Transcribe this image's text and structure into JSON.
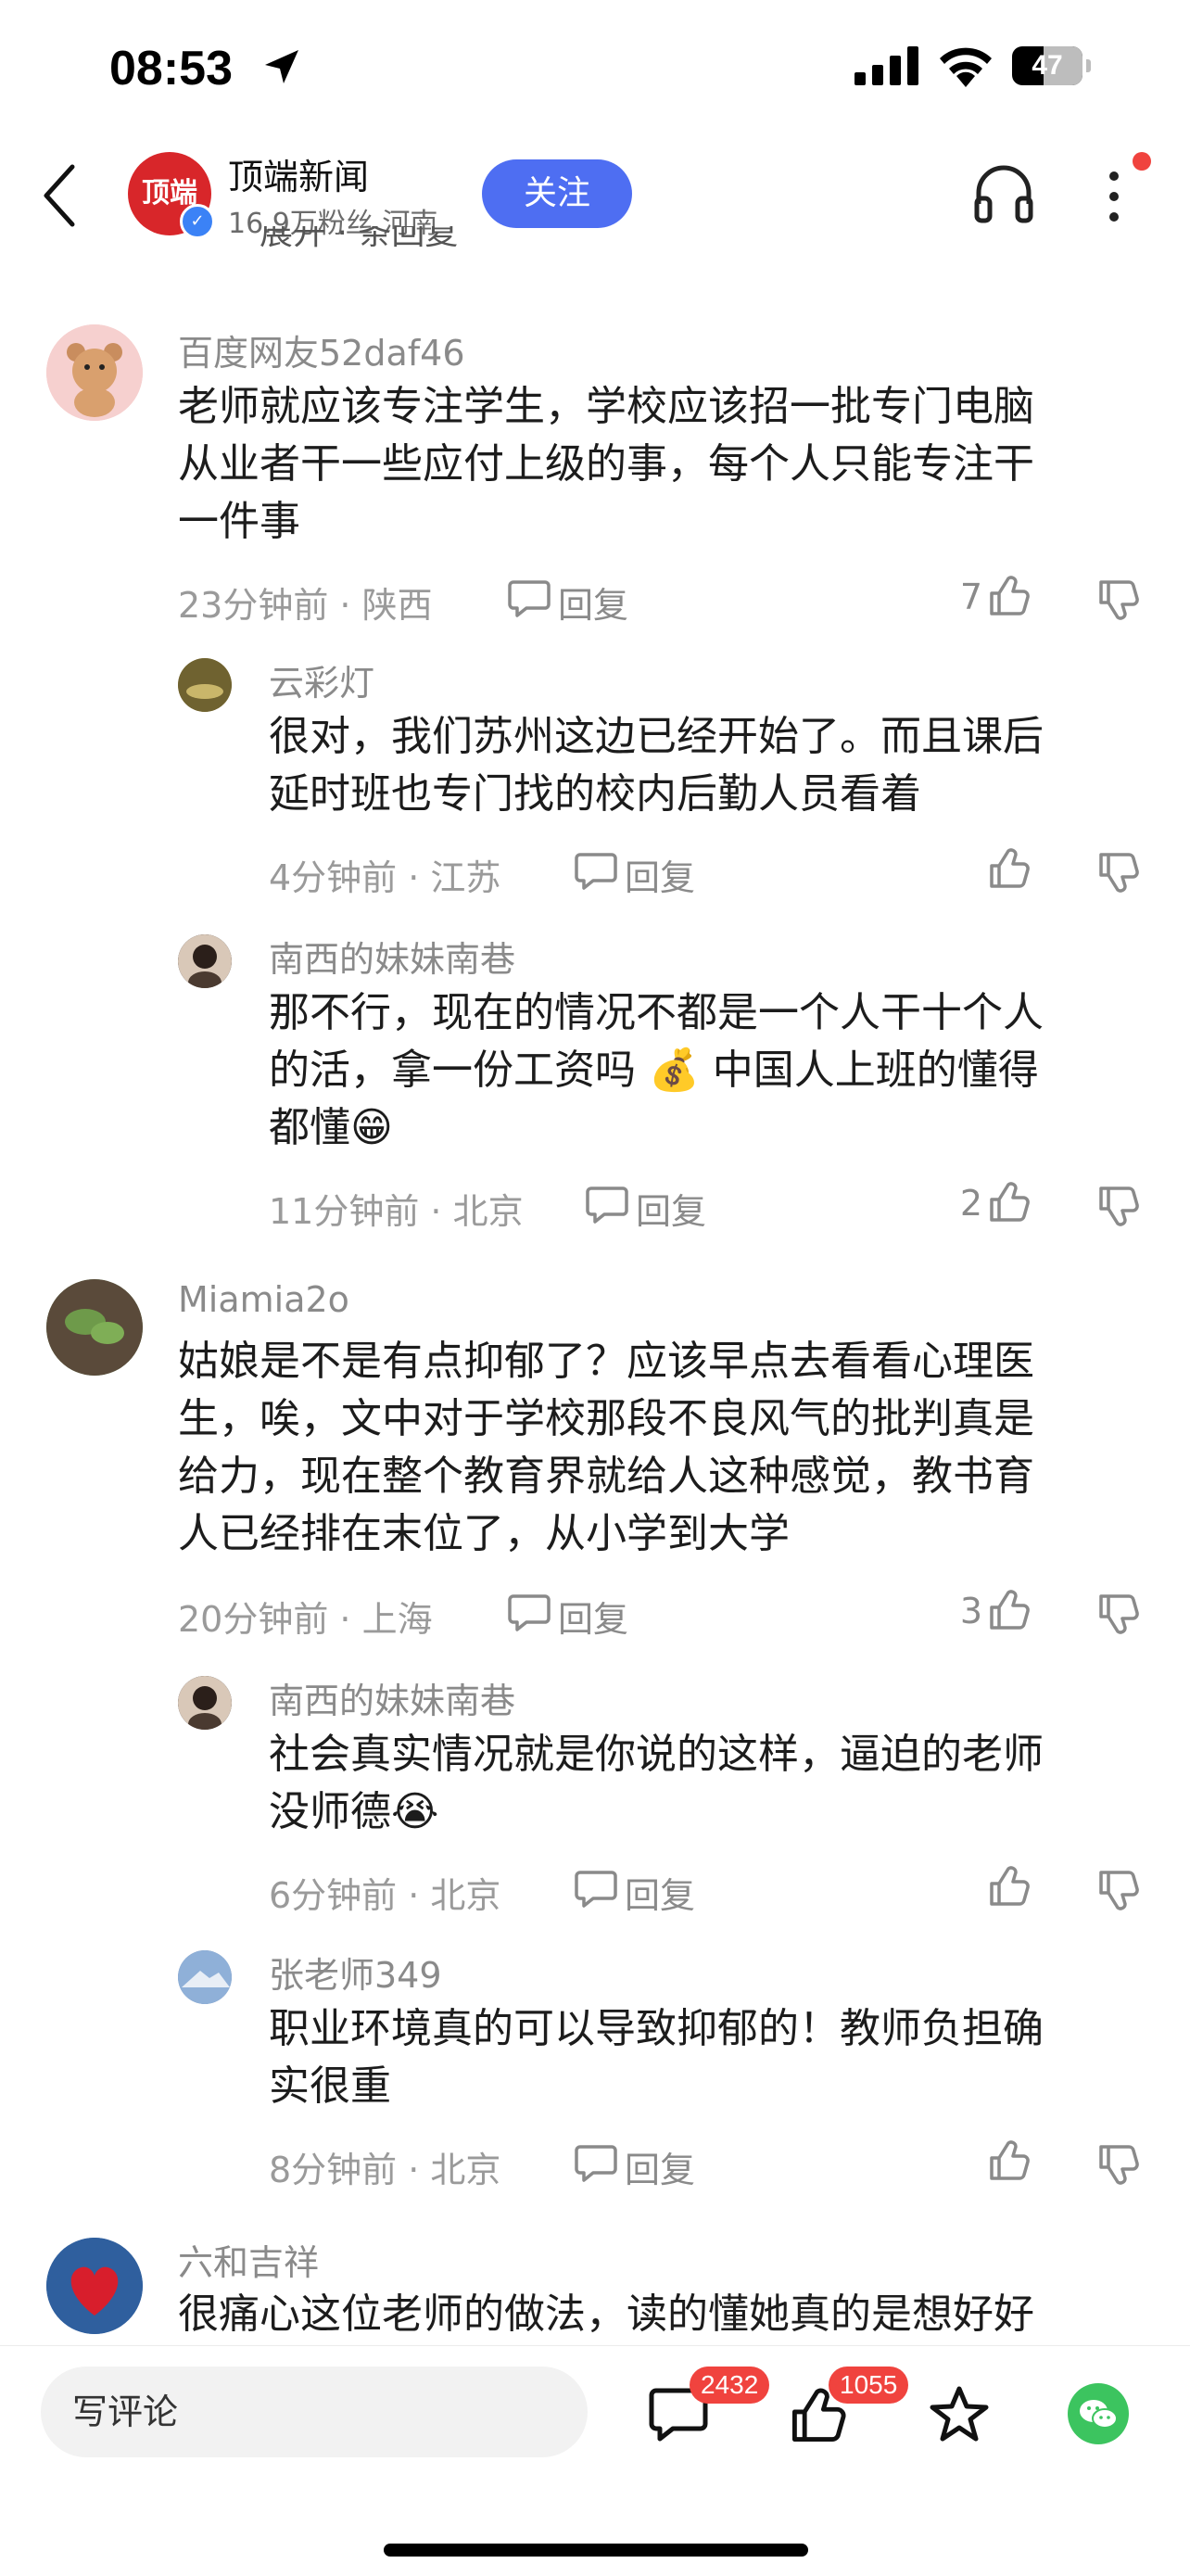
{
  "status_bar": {
    "time": "08:53",
    "battery": "47"
  },
  "header": {
    "logo_text": "顶端",
    "source_name": "顶端新闻",
    "source_meta": "16.9万粉丝  河南",
    "follow_label": "关注"
  },
  "peek_text": "展开 · 条回复",
  "comments": [
    {
      "user": "百度网友52daf46",
      "text_lines": [
        "老师就应该专注学生，学校应该招一批专门电脑",
        "从业者干一些应付上级的事，每个人只能专注干",
        "一件事"
      ],
      "meta": "23分钟前 · 陕西",
      "reply_label": "回复",
      "likes": "7",
      "replies": [
        {
          "user": "云彩灯",
          "text_lines": [
            "很对，我们苏州这边已经开始了。而且课后",
            "延时班也专门找的校内后勤人员看着"
          ],
          "meta": "4分钟前 · 江苏",
          "reply_label": "回复",
          "likes": ""
        },
        {
          "user": "南西的妹妹南巷",
          "text_lines": [
            "那不行，现在的情况不都是一个人干十个人",
            "的活，拿一份工资吗 💰 中国人上班的懂得",
            "都懂😁"
          ],
          "meta": "11分钟前 · 北京",
          "reply_label": "回复",
          "likes": "2"
        }
      ]
    },
    {
      "user": "Miamia2o",
      "text_lines": [
        "姑娘是不是有点抑郁了？应该早点去看看心理医",
        "生，唉，文中对于学校那段不良风气的批判真是",
        "给力，现在整个教育界就给人这种感觉，教书育",
        "人已经排在末位了，从小学到大学"
      ],
      "meta": "20分钟前 · 上海",
      "reply_label": "回复",
      "likes": "3",
      "replies": [
        {
          "user": "南西的妹妹南巷",
          "text_lines": [
            "社会真实情况就是你说的这样，逼迫的老师",
            "没师德😭"
          ],
          "meta": "6分钟前 · 北京",
          "reply_label": "回复",
          "likes": ""
        },
        {
          "user": "张老师349",
          "text_lines": [
            "职业环境真的可以导致抑郁的！教师负担确",
            "实很重"
          ],
          "meta": "8分钟前 · 北京",
          "reply_label": "回复",
          "likes": ""
        }
      ]
    },
    {
      "user": "六和吉祥",
      "text_lines": [
        "很痛心这位老师的做法，读的懂她真的是想好好"
      ]
    }
  ],
  "bottom_bar": {
    "input_placeholder": "写评论",
    "comment_count": "2432",
    "like_count": "1055"
  },
  "colors": {
    "accent": "#4e6ef2",
    "badge": "#f0433e",
    "wechat": "#3cc45f",
    "brand": "#d8262a"
  }
}
